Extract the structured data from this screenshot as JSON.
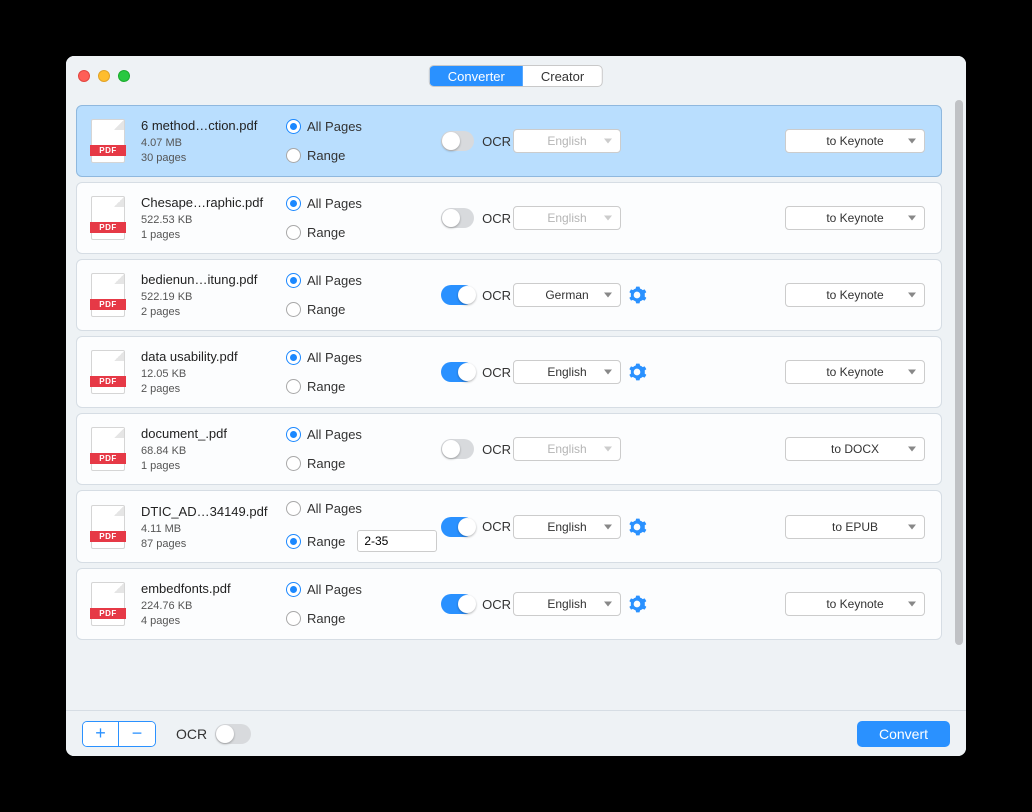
{
  "tabs": {
    "converter": "Converter",
    "creator": "Creator",
    "active": "converter"
  },
  "pdf_badge": "PDF",
  "labels": {
    "all_pages": "All Pages",
    "range": "Range",
    "ocr": "OCR"
  },
  "files": [
    {
      "name": "6 method…ction.pdf",
      "size": "4.07 MB",
      "pages": "30 pages",
      "pages_mode": "all",
      "range_value": "",
      "ocr_on": false,
      "language": "English",
      "output": "to Keynote",
      "selected": true
    },
    {
      "name": "Chesape…raphic.pdf",
      "size": "522.53 KB",
      "pages": "1 pages",
      "pages_mode": "all",
      "range_value": "",
      "ocr_on": false,
      "language": "English",
      "output": "to Keynote",
      "selected": false
    },
    {
      "name": "bedienun…itung.pdf",
      "size": "522.19 KB",
      "pages": "2 pages",
      "pages_mode": "all",
      "range_value": "",
      "ocr_on": true,
      "language": "German",
      "output": "to Keynote",
      "selected": false
    },
    {
      "name": "data usability.pdf",
      "size": "12.05 KB",
      "pages": "2 pages",
      "pages_mode": "all",
      "range_value": "",
      "ocr_on": true,
      "language": "English",
      "output": "to Keynote",
      "selected": false
    },
    {
      "name": "document_.pdf",
      "size": "68.84 KB",
      "pages": "1 pages",
      "pages_mode": "all",
      "range_value": "",
      "ocr_on": false,
      "language": "English",
      "output": "to DOCX",
      "selected": false
    },
    {
      "name": "DTIC_AD…34149.pdf",
      "size": "4.11 MB",
      "pages": "87 pages",
      "pages_mode": "range",
      "range_value": "2-35",
      "ocr_on": true,
      "language": "English",
      "output": "to EPUB",
      "selected": false
    },
    {
      "name": "embedfonts.pdf",
      "size": "224.76 KB",
      "pages": "4 pages",
      "pages_mode": "all",
      "range_value": "",
      "ocr_on": true,
      "language": "English",
      "output": "to Keynote",
      "selected": false
    }
  ],
  "footer": {
    "ocr_label": "OCR",
    "ocr_on": false,
    "convert": "Convert",
    "add": "+",
    "remove": "−"
  }
}
